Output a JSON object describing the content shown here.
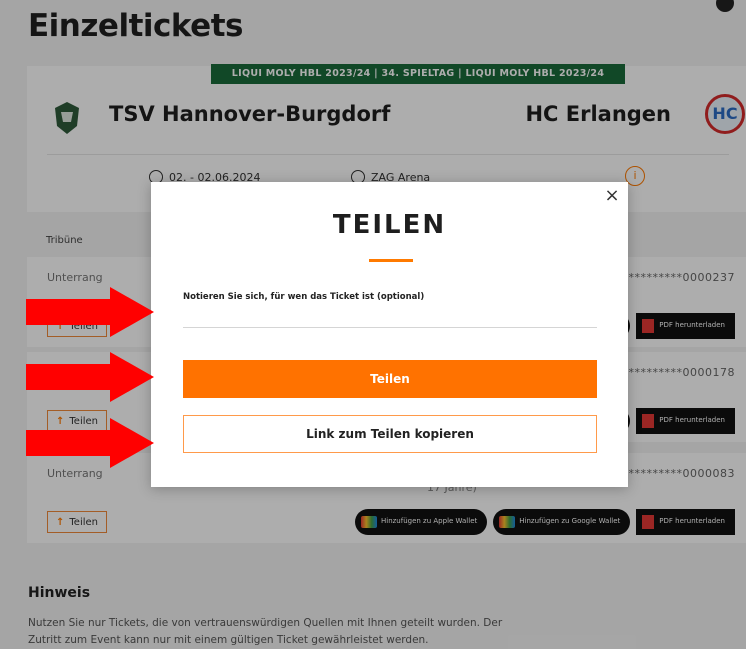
{
  "page": {
    "title": "Einzeltickets"
  },
  "match": {
    "league_banner": "LIQUI MOLY HBL 2023/24 | 34. SPIELTAG | LIQUI MOLY HBL 2023/24",
    "home_team": "TSV Hannover-Burgdorf",
    "away_team": "HC Erlangen",
    "away_logo_text": "HC",
    "date": "02. - 02.06.2024",
    "venue": "ZAG Arena",
    "info_icon_label": "i"
  },
  "tickets_header": {
    "tribune": "Tribüne"
  },
  "tickets": [
    {
      "tribune": "Unterrang",
      "number": "*********0000237",
      "share_label": "Teilen",
      "age_note": ""
    },
    {
      "tribune": "",
      "number": "*********0000178",
      "share_label": "Teilen",
      "age_note": ""
    },
    {
      "tribune": "Unterrang",
      "number": "*********0000083",
      "share_label": "Teilen",
      "age_note": "17 Jahre)"
    }
  ],
  "wallets": {
    "apple": "Hinzufügen zu Apple Wallet",
    "google": "Hinzufügen zu Google Wallet",
    "google_partial": "llet",
    "pdf": "PDF herunterladen"
  },
  "hint": {
    "title": "Hinweis",
    "text": "Nutzen Sie nur Tickets, die von vertrauenswürdigen Quellen mit Ihnen geteilt wurden. Der Zutritt zum Event kann nur mit einem gültigen Ticket gewährleistet werden."
  },
  "modal": {
    "close_symbol": "×",
    "title": "TEILEN",
    "note_label": "Notieren Sie sich, für wen das Ticket ist (optional)",
    "note_value": "",
    "note_placeholder": "",
    "share_button": "Teilen",
    "copy_link_button": "Link zum Teilen kopieren"
  },
  "colors": {
    "accent": "#ff7200",
    "league_green": "#1a6a3a",
    "arrow_red": "#ff0000",
    "overlay": "rgba(0,0,0,0.32)"
  },
  "annotations": {
    "arrow_count": 3
  }
}
